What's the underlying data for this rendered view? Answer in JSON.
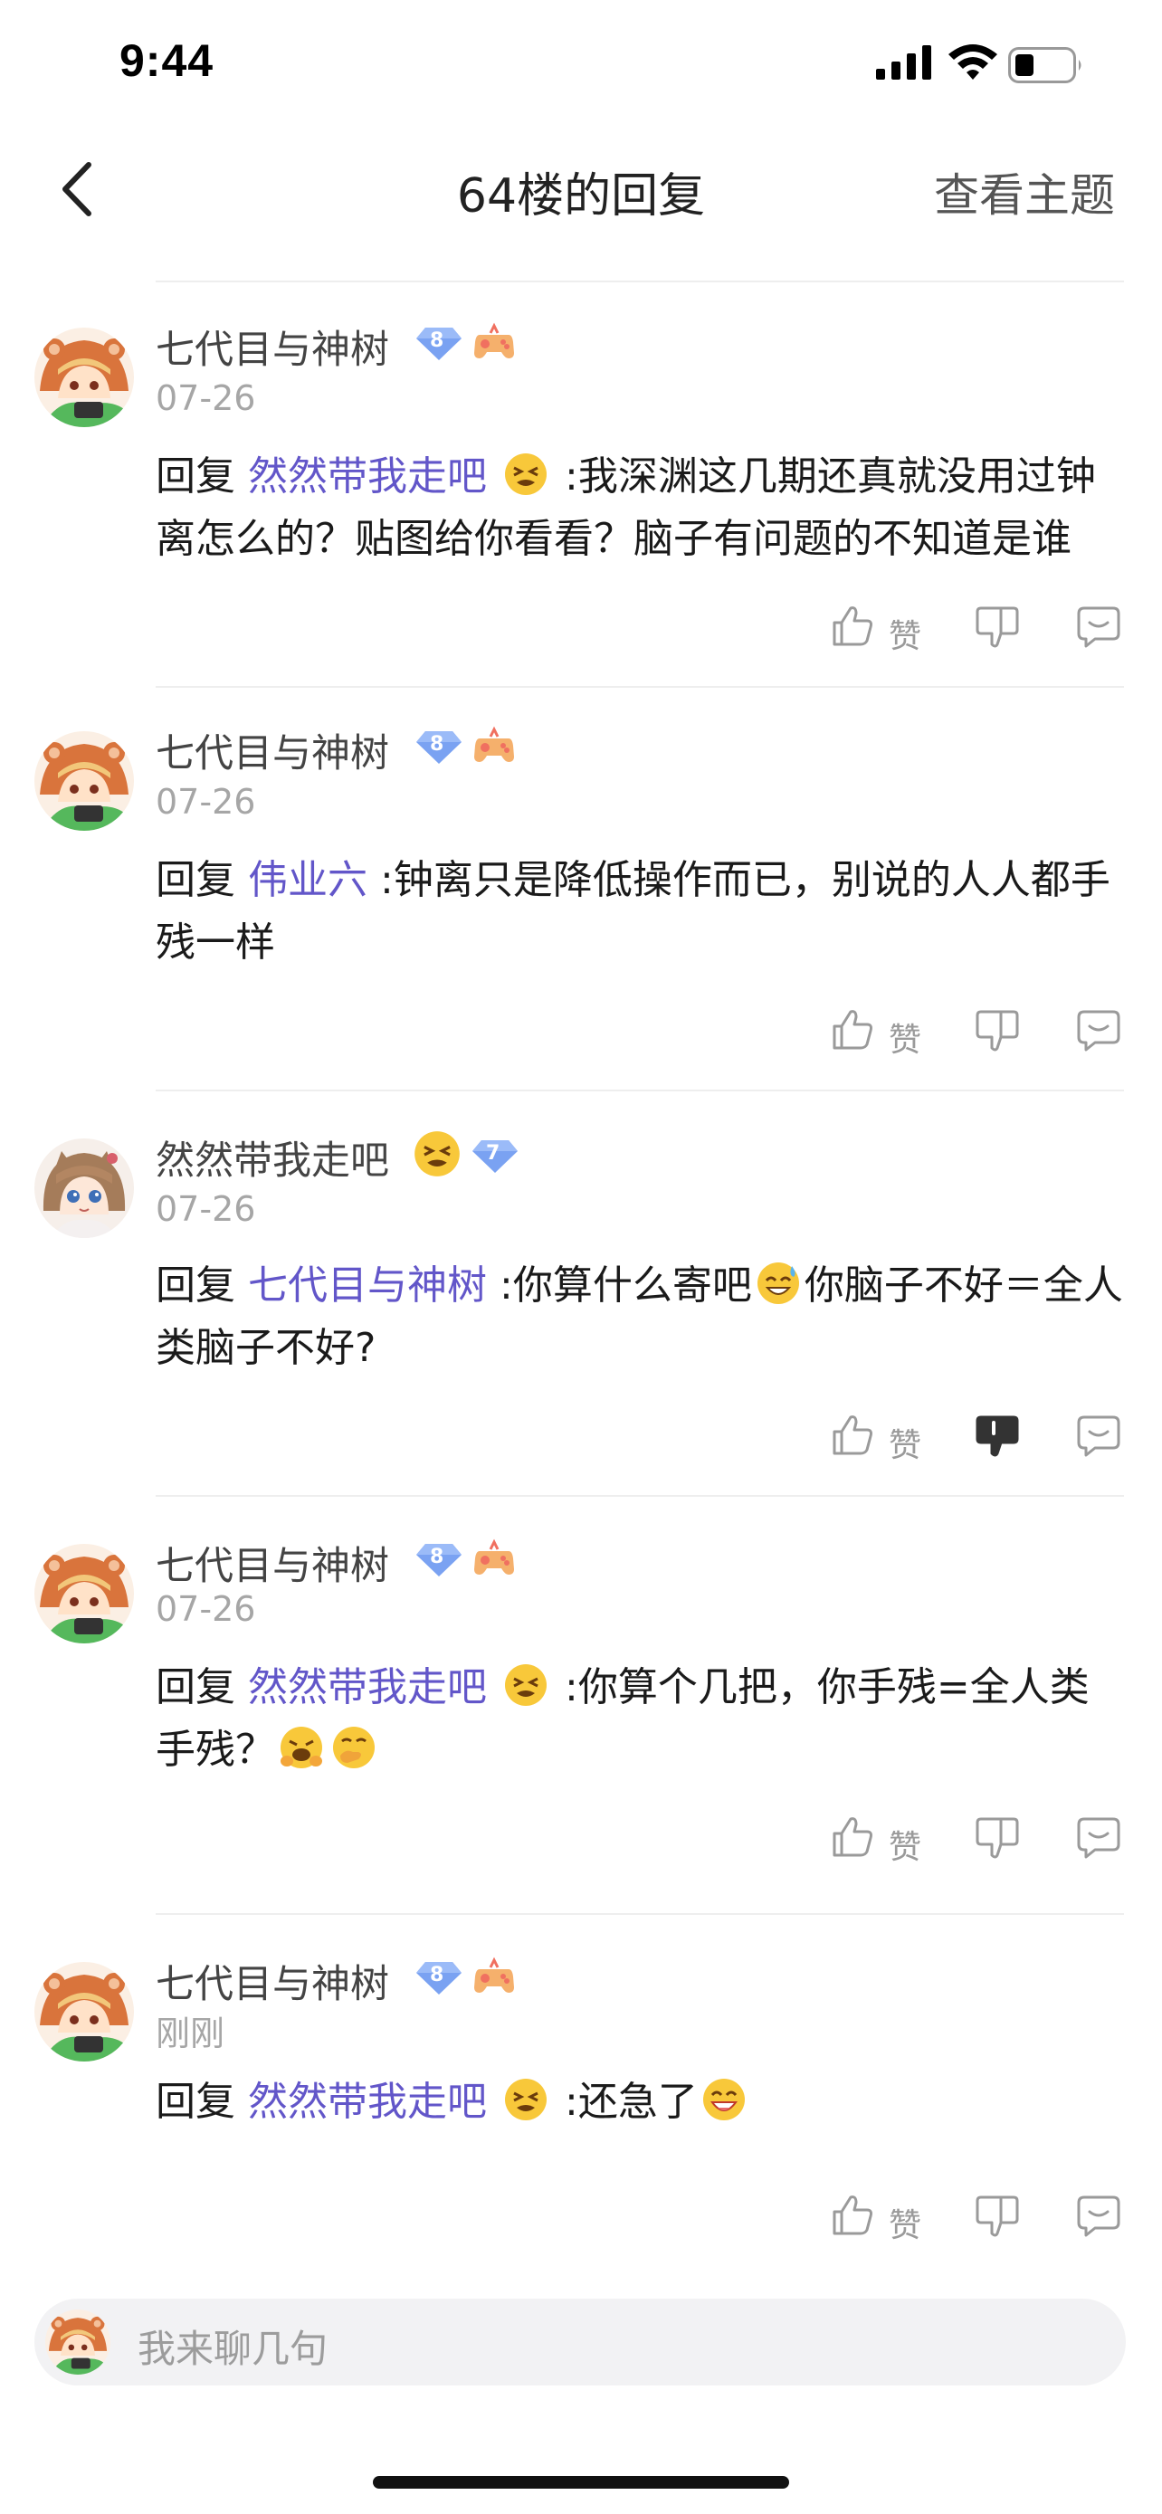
{
  "status_bar": {
    "time": "9:44"
  },
  "nav": {
    "title": "64楼的回复",
    "action": "查看主题"
  },
  "comments": [
    {
      "username": "七代目与神树",
      "level": "8",
      "date": "07-26",
      "reply_prefix": "回复",
      "mention": "然然带我走吧",
      "text": " :我深渊这几期还真就没用过钟离怎么的？贴图给你看看？脑子有问题的不知道是谁",
      "like_label": "赞",
      "disliked": false
    },
    {
      "username": "七代目与神树",
      "level": "8",
      "date": "07-26",
      "reply_prefix": "回复",
      "mention": "伟业六",
      "text": " :钟离只是降低操作而已，别说的人人都手残一样",
      "like_label": "赞",
      "disliked": false
    },
    {
      "username": "然然带我走吧",
      "level": "7",
      "date": "07-26",
      "reply_prefix": "回复",
      "mention": "七代目与神树",
      "text_a": " :你算什么寄吧",
      "text_b": "你脑子不好＝全人类脑子不好?",
      "like_label": "赞",
      "disliked": true
    },
    {
      "username": "七代目与神树",
      "level": "8",
      "date": "07-26",
      "reply_prefix": "回复",
      "mention": "然然带我走吧",
      "text": " :你算个几把，你手残=全人类手残？",
      "like_label": "赞",
      "disliked": false
    },
    {
      "username": "七代目与神树",
      "level": "8",
      "date": "刚刚",
      "reply_prefix": "回复",
      "mention": "然然带我走吧",
      "text": " :还急了",
      "like_label": "赞",
      "disliked": false
    }
  ],
  "input": {
    "placeholder": "我来聊几句"
  },
  "colors": {
    "mention": "#6256c9",
    "badge": "#7aa2f2",
    "disliked": "#333333"
  }
}
